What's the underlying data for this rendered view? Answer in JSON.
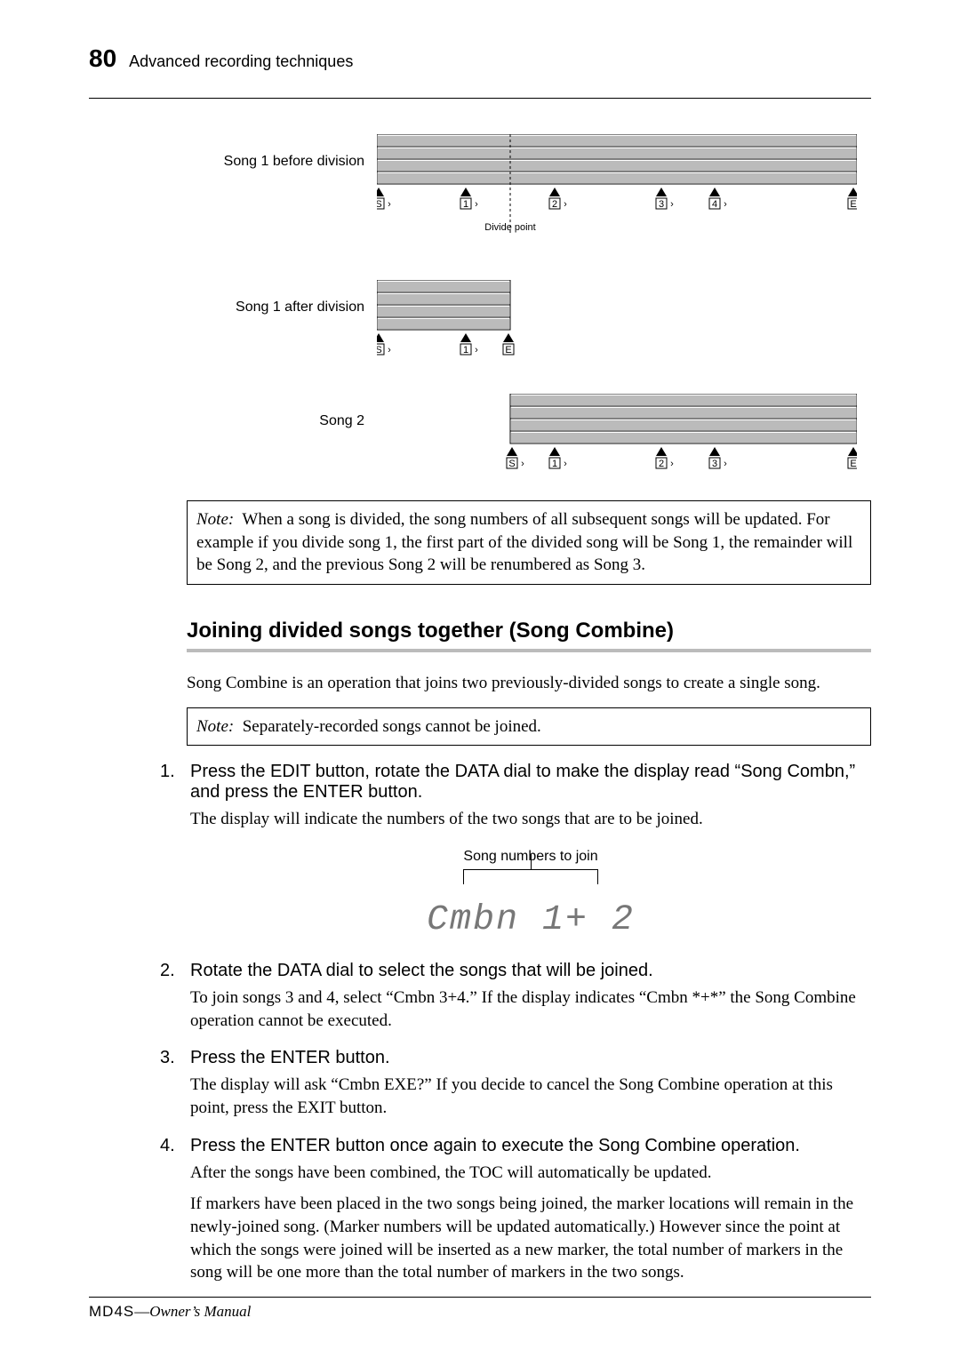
{
  "header": {
    "page": "80",
    "chapter": "Advanced recording techniques"
  },
  "diagram": {
    "row1_label": "Song 1 before division",
    "row1_divide_label": "Divide point",
    "row2_label": "Song 1 after division",
    "row3_label": "Song 2",
    "markers": {
      "S": "S",
      "1": "1",
      "2": "2",
      "3": "3",
      "4": "4",
      "E": "E"
    }
  },
  "note1": {
    "label": "Note:",
    "text": "When a song is divided, the song numbers of all subsequent songs will be updated. For example if you divide song 1, the first part of the divided song will be Song 1, the remainder will be Song 2, and the previous Song 2 will be renumbered as Song 3."
  },
  "heading": "Joining divided songs together (Song Combine)",
  "intro": "Song Combine is an operation that joins two previously-divided songs to create a single song.",
  "note2": {
    "label": "Note:",
    "text": "Separately-recorded songs cannot be joined."
  },
  "steps": {
    "s1_title": "Press the EDIT button, rotate the DATA dial to make the display read “Song Combn,” and press the ENTER button.",
    "s1_body": "The display will indicate the numbers of the two songs that are to be joined.",
    "lcd_caption": "Song numbers to join",
    "lcd_text": "Cmbn 1+ 2",
    "s2_title": "Rotate the DATA dial to select the songs that will be joined.",
    "s2_body": "To join songs 3 and 4, select “Cmbn 3+4.” If the display indicates “Cmbn *+*” the Song Combine operation cannot be executed.",
    "s3_title": "Press the ENTER button.",
    "s3_body": "The display will ask “Cmbn EXE?” If you decide to cancel the Song Combine operation at this point, press the EXIT button.",
    "s4_title": "Press the ENTER button once again to execute the Song Combine operation.",
    "s4_body1": "After the songs have been combined, the TOC will automatically be updated.",
    "s4_body2": "If markers have been placed in the two songs being joined, the marker locations will remain in the newly-joined song. (Marker numbers will be updated automatically.) However since the point at which the songs were joined will be inserted as a new marker, the total number of markers in the song will be one more than the total number of markers in the two songs."
  },
  "footer": {
    "model": "MD4S",
    "dash": "—",
    "owner": "Owner’s Manual"
  }
}
